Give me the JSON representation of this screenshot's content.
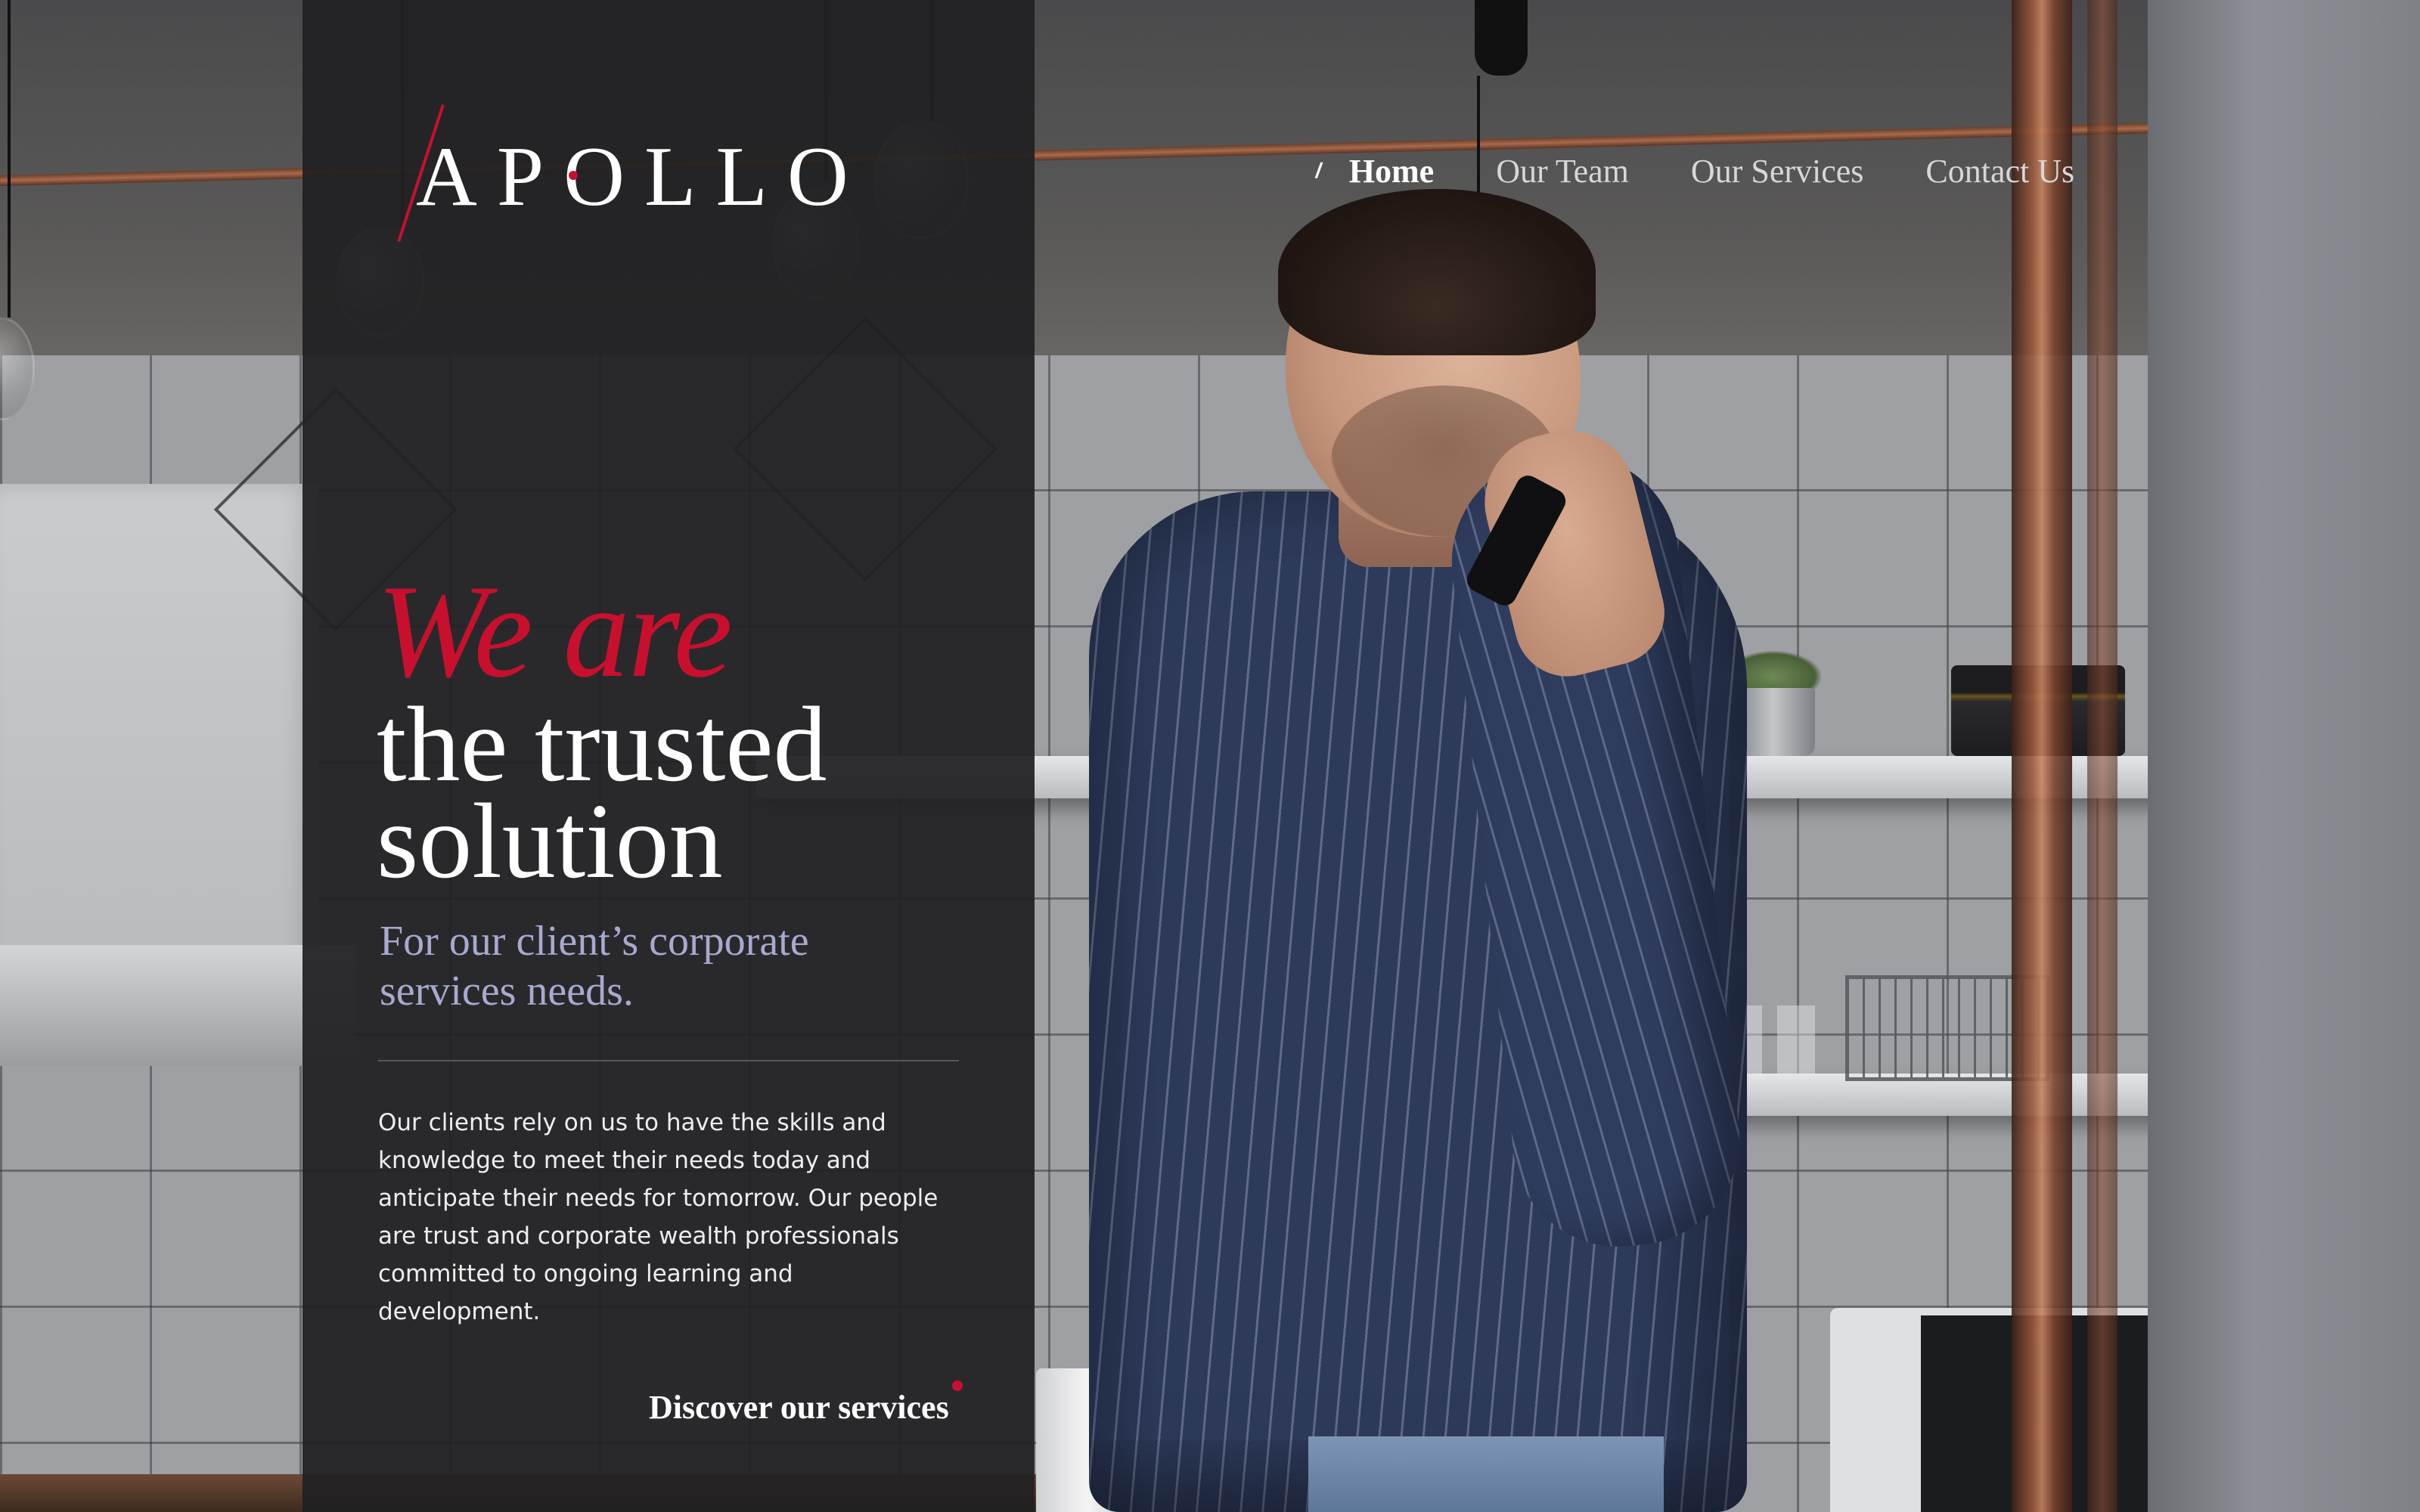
{
  "brand": {
    "name": "APOLLO",
    "accent_color": "#c8102e"
  },
  "nav": {
    "items": [
      {
        "label": "Home",
        "active": true
      },
      {
        "label": "Our Team",
        "active": false
      },
      {
        "label": "Our Services",
        "active": false
      },
      {
        "label": "Contact Us",
        "active": false
      }
    ],
    "active_marker": "/"
  },
  "hero": {
    "accent_line": "We are",
    "headline": "the trusted solution",
    "subheadline": "For our client’s corporate services needs.",
    "body": "Our clients rely on us to have the skills and knowledge to meet their needs today and anticipate their needs for tomorrow. Our people are trust and corporate wealth professionals committed to ongoing learning and development.",
    "cta_label": "Discover our services"
  },
  "colors": {
    "panel": "#202022",
    "accent": "#c8102e",
    "subheadline": "#a7a9cf",
    "text": "#ffffff"
  }
}
